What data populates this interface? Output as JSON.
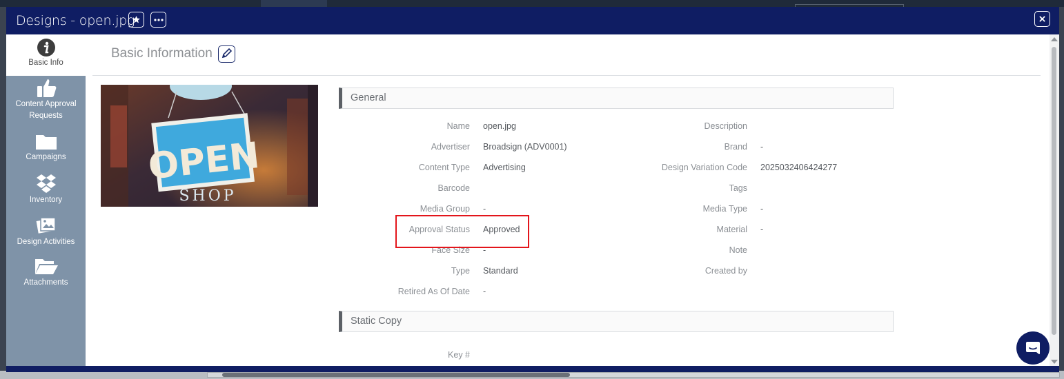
{
  "window": {
    "title": "Designs - open.jpg"
  },
  "sidebar": {
    "items": [
      {
        "label": "Basic Info",
        "icon": "info-icon"
      },
      {
        "label": "Content Approval Requests",
        "icon": "thumbs-up-icon"
      },
      {
        "label": "Campaigns",
        "icon": "folder-icon"
      },
      {
        "label": "Inventory",
        "icon": "dropbox-icon"
      },
      {
        "label": "Design Activities",
        "icon": "photos-icon"
      },
      {
        "label": "Attachments",
        "icon": "folder-open-icon"
      }
    ]
  },
  "header": {
    "title": "Basic Information"
  },
  "image": {
    "sign_text": "OPEN",
    "sub_text": "SHOP"
  },
  "sections": {
    "general": "General",
    "static_copy": "Static Copy"
  },
  "fields_left": [
    {
      "label": "Name",
      "value": "open.jpg"
    },
    {
      "label": "Advertiser",
      "value": "Broadsign (ADV0001)"
    },
    {
      "label": "Content Type",
      "value": "Advertising"
    },
    {
      "label": "Barcode",
      "value": ""
    },
    {
      "label": "Media Group",
      "value": "-"
    },
    {
      "label": "Approval Status",
      "value": "Approved"
    },
    {
      "label": "Face Size",
      "value": "-"
    },
    {
      "label": "Type",
      "value": "Standard"
    },
    {
      "label": "Retired As Of Date",
      "value": "-"
    }
  ],
  "fields_right": [
    {
      "label": "Description",
      "value": ""
    },
    {
      "label": "Brand",
      "value": "-"
    },
    {
      "label": "Design Variation Code",
      "value": "2025032406424277"
    },
    {
      "label": "Tags",
      "value": ""
    },
    {
      "label": "Media Type",
      "value": "-"
    },
    {
      "label": "Material",
      "value": "-"
    },
    {
      "label": "Note",
      "value": ""
    },
    {
      "label": "Created by",
      "value": ""
    }
  ],
  "static_copy": {
    "key_label": "Key #"
  },
  "colors": {
    "titlebar": "#0f1d63",
    "sidebar": "#7f93a8",
    "highlight": "#e3151b"
  }
}
